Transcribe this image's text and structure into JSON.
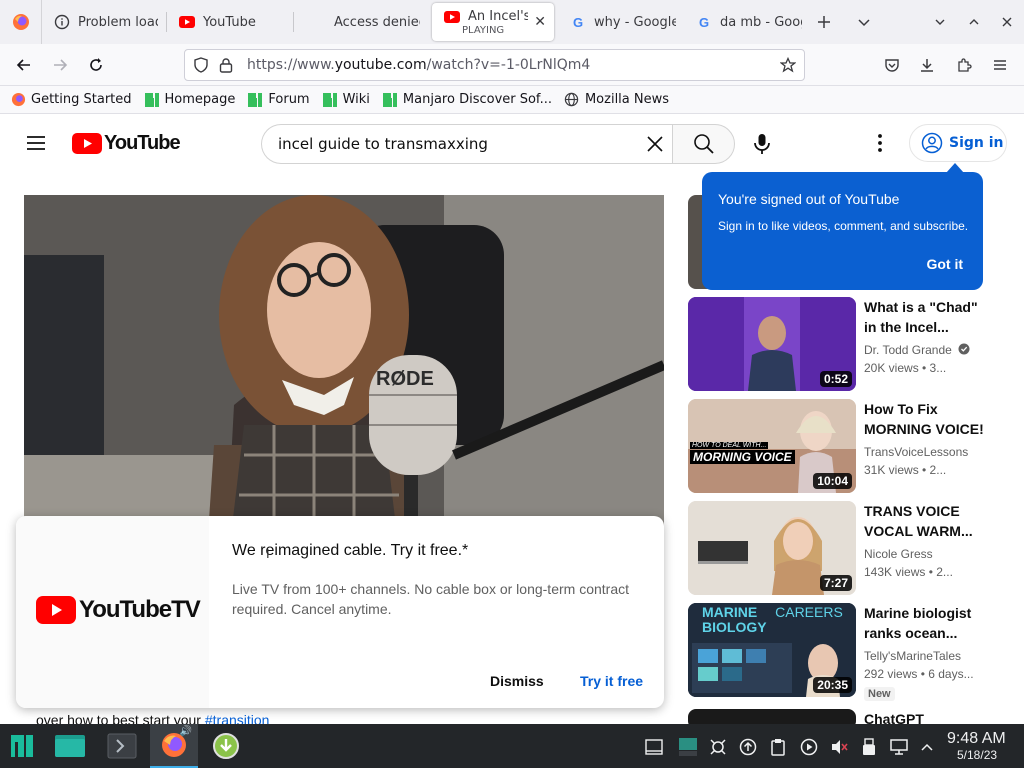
{
  "browser": {
    "tabs": [
      {
        "label": "Problem load",
        "icon": "info-icon"
      },
      {
        "label": "YouTube",
        "icon": "youtube-icon"
      },
      {
        "label": "Access denied",
        "icon": "none"
      },
      {
        "label": "An Incel's g",
        "sublabel": "PLAYING",
        "icon": "youtube-icon",
        "active": true
      },
      {
        "label": "why - Google",
        "icon": "google-icon"
      },
      {
        "label": "da mb - Goog",
        "icon": "google-icon"
      }
    ],
    "url": {
      "prefix": "https://www.",
      "host": "youtube.com",
      "rest": "/watch?v=-1-0LrNlQm4"
    },
    "bookmarks": [
      {
        "label": "Getting Started",
        "icon": "firefox-icon"
      },
      {
        "label": "Homepage",
        "icon": "manjaro-icon"
      },
      {
        "label": "Forum",
        "icon": "manjaro-icon"
      },
      {
        "label": "Wiki",
        "icon": "manjaro-icon"
      },
      {
        "label": "Manjaro Discover Sof...",
        "icon": "manjaro-icon"
      },
      {
        "label": "Mozilla News",
        "icon": "globe-icon"
      }
    ]
  },
  "youtube": {
    "logo_text": "YouTube",
    "search_value": "incel guide to transmaxxing",
    "sign_in_label": "Sign in",
    "signed_out_popup": {
      "title": "You're signed out of YouTube",
      "body": "Sign in to like videos, comment, and subscribe.",
      "button": "Got it"
    },
    "recommendations": [
      {
        "title": "What is a \"Chad\" in the Incel...",
        "channel": "Dr. Todd Grande",
        "verified": true,
        "meta": "20K views • 3...",
        "duration": "0:52"
      },
      {
        "title": "How To Fix MORNING VOICE!",
        "channel": "TransVoiceLessons",
        "meta": "31K views • 2...",
        "duration": "10:04",
        "thumb_text": [
          "HOW TO DEAL WITH...",
          "MORNING VOICE"
        ]
      },
      {
        "title": "TRANS VOICE VOCAL WARM...",
        "channel": "Nicole Gress",
        "meta": "143K views • 2...",
        "duration": "7:27"
      },
      {
        "title": "Marine biologist ranks ocean...",
        "channel": "Telly'sMarineTales",
        "meta": "292 views • 6 days...",
        "duration": "20:35",
        "badge": "New",
        "thumb_text": [
          "MARINE",
          "BIOLOGY",
          "CAREERS"
        ]
      },
      {
        "title": "ChatGPT"
      }
    ],
    "player": {
      "mic_text": "RØDE"
    },
    "promo": {
      "logo_text": "YouTubeTV",
      "heading": "We reimagined cable. Try it free.*",
      "body": "Live TV from 100+ channels. No cable box or long-term contract required. Cancel anytime.",
      "dismiss": "Dismiss",
      "try": "Try it free"
    },
    "description_line": {
      "text": "over how to best start your ",
      "hashtag": "#transition"
    }
  },
  "taskbar": {
    "time": "9:48 AM",
    "date": "5/18/23"
  },
  "colors": {
    "youtube_red": "#ff0000",
    "link_blue": "#065fd4",
    "popup_blue": "#0b60d1",
    "manjaro_green": "#35bf5c",
    "taskbar": "#232629"
  }
}
